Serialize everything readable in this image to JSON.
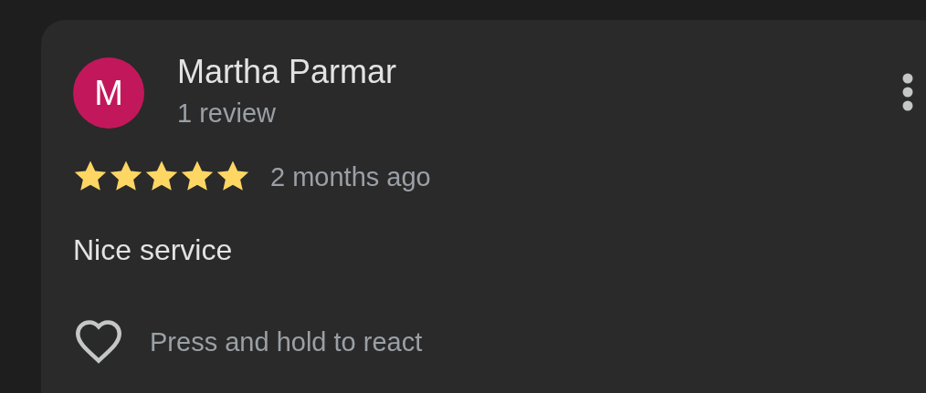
{
  "review": {
    "avatar_letter": "M",
    "author": "Martha Parmar",
    "review_count": "1 review",
    "stars": 5,
    "time": "2 months ago",
    "text": "Nice service",
    "react_hint": "Press and hold to react"
  }
}
